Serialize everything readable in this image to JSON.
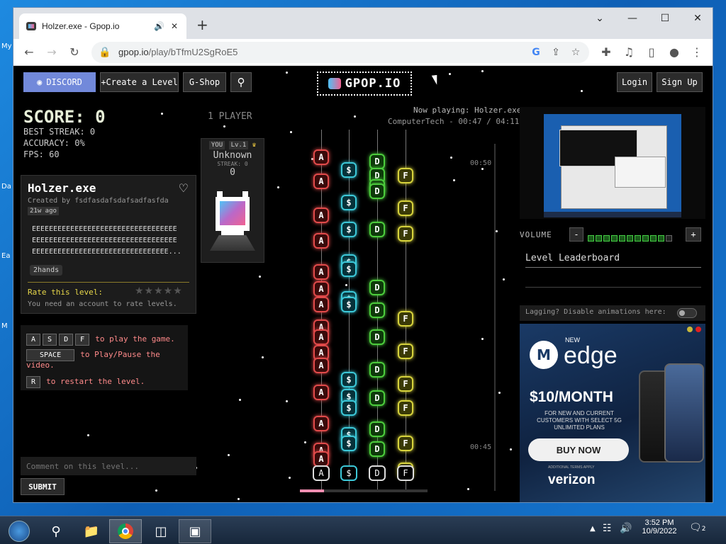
{
  "desktop": {
    "labels": [
      "My",
      "Da",
      "Ea",
      "M"
    ]
  },
  "browser": {
    "tab_title": "Holzer.exe - Gpop.io",
    "url_host": "gpop.io",
    "url_path": "/play/bTfmU2SgRoE5",
    "window_controls": {
      "minimize": "—",
      "maximize": "☐",
      "close": "✕",
      "chevron": "⌄"
    }
  },
  "header": {
    "discord_label": "DISCORD",
    "create_label": "+Create a Level",
    "gshop_label": "G-Shop",
    "logo_text": "GPOP.IO",
    "login_label": "Login",
    "signup_label": "Sign Up"
  },
  "stats": {
    "score": "SCORE: 0",
    "best_streak": "BEST STREAK: 0",
    "accuracy": "ACCURACY: 0%",
    "fps": "FPS: 60"
  },
  "player": {
    "mode": "1 PLAYER",
    "you_badge": "YOU",
    "level_badge": "Lv.1",
    "name": "Unknown",
    "streak": "STREAK: 0",
    "score": "0"
  },
  "level": {
    "title": "Holzer.exe",
    "created_by": "Created by fsdfasdafsdafsadfasfda",
    "age": "21w ago",
    "description": [
      "EEEEEEEEEEEEEEEEEEEEEEEEEEEEEEEEEE",
      "EEEEEEEEEEEEEEEEEEEEEEEEEEEEEEEEEE",
      "EEEEEEEEEEEEEEEEEEEEEEEEEEEEEEEE..."
    ],
    "tag": "2hands",
    "rate_label": "Rate this level:",
    "rate_note": "You need an account to rate levels.",
    "rating": 0
  },
  "controls": {
    "keys": [
      "A",
      "S",
      "D",
      "F"
    ],
    "play_text": "to play the game.",
    "space_key": "SPACE",
    "pause_text": "to Play/Pause the",
    "pause_text2": "video.",
    "restart_key": "R",
    "restart_text": "to restart the level."
  },
  "comment": {
    "placeholder": "Comment on this level...",
    "submit": "SUBMIT"
  },
  "now_playing": {
    "line1": "Now playing: Holzer.exe",
    "line2": "ComputerTech - 00:47 / 04:11"
  },
  "timeline": {
    "mark1": "00:50",
    "mark2": "00:45"
  },
  "volume": {
    "label": "VOLUME",
    "minus": "-",
    "plus": "+",
    "level": 0.9
  },
  "leaderboard": {
    "title": "Level Leaderboard"
  },
  "lag": {
    "text": "Lagging? Disable animations here:"
  },
  "ad": {
    "new": "NEW",
    "brand": "edge",
    "price": "$10/MONTH",
    "fine1": "FOR NEW AND CURRENT",
    "fine2": "CUSTOMERS WITH SELECT 5G",
    "fine3": "UNLIMITED PLANS",
    "cta": "BUY NOW",
    "small": "ADDITIONAL TERMS APPLY",
    "carrier": "verizon"
  },
  "progress": 0.19,
  "taskbar": {
    "time": "3:52 PM",
    "date": "10/9/2022",
    "notif_count": "2"
  }
}
